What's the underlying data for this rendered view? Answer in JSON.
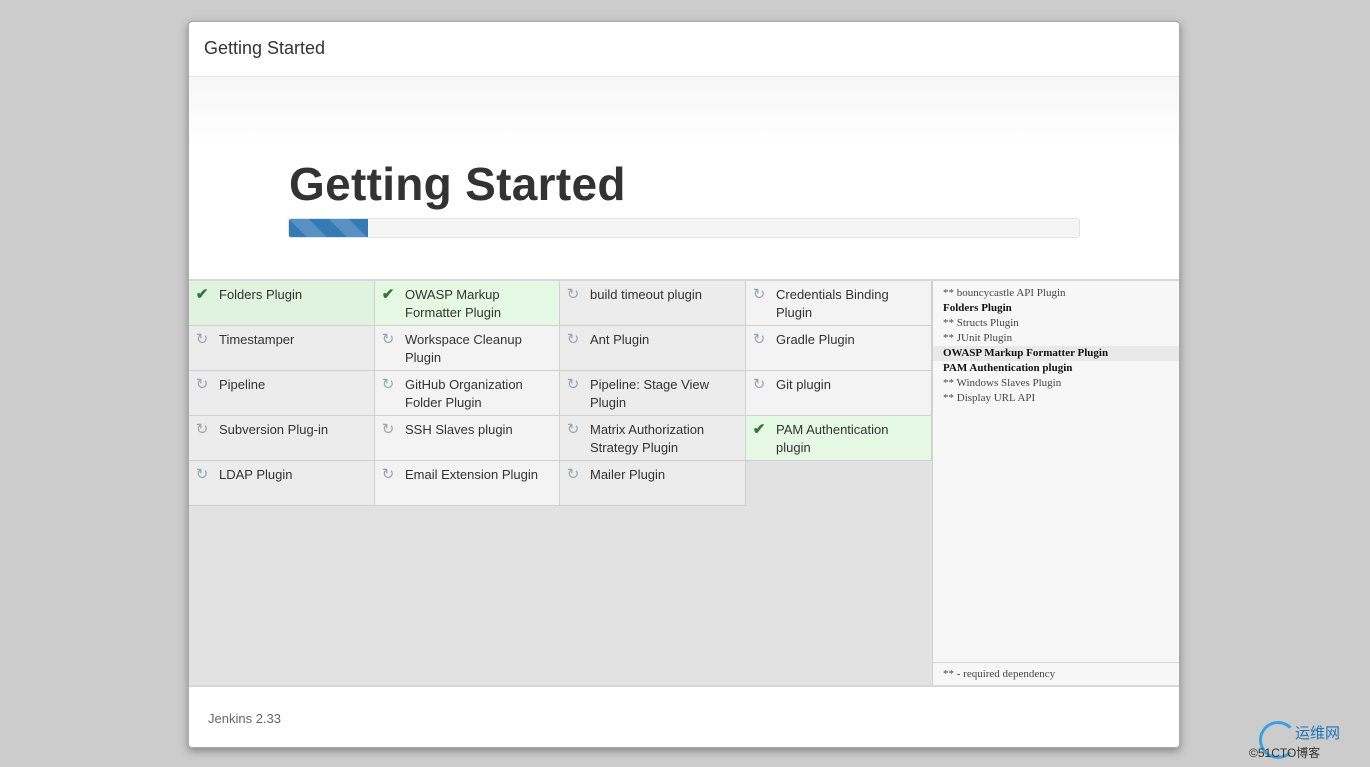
{
  "dialog": {
    "title": "Getting Started",
    "hero_title": "Getting Started",
    "progress_fraction": 0.1
  },
  "plugins": [
    {
      "label": "Folders Plugin",
      "status": "installed"
    },
    {
      "label": "OWASP Markup Formatter Plugin",
      "status": "installed"
    },
    {
      "label": "build timeout plugin",
      "status": "pending"
    },
    {
      "label": "Credentials Binding Plugin",
      "status": "pending"
    },
    {
      "label": "Timestamper",
      "status": "pending"
    },
    {
      "label": "Workspace Cleanup Plugin",
      "status": "pending"
    },
    {
      "label": "Ant Plugin",
      "status": "pending"
    },
    {
      "label": "Gradle Plugin",
      "status": "pending"
    },
    {
      "label": "Pipeline",
      "status": "pending"
    },
    {
      "label": "GitHub Organization Folder Plugin",
      "status": "pending"
    },
    {
      "label": "Pipeline: Stage View Plugin",
      "status": "pending"
    },
    {
      "label": "Git plugin",
      "status": "pending"
    },
    {
      "label": "Subversion Plug-in",
      "status": "pending"
    },
    {
      "label": "SSH Slaves plugin",
      "status": "pending"
    },
    {
      "label": "Matrix Authorization Strategy Plugin",
      "status": "pending"
    },
    {
      "label": "PAM Authentication plugin",
      "status": "installed"
    },
    {
      "label": "LDAP Plugin",
      "status": "pending"
    },
    {
      "label": "Email Extension Plugin",
      "status": "pending"
    },
    {
      "label": "Mailer Plugin",
      "status": "pending"
    }
  ],
  "install_log": {
    "lines": [
      {
        "text": "** bouncycastle API Plugin",
        "installed": false
      },
      {
        "text": "Folders Plugin",
        "installed": true
      },
      {
        "text": "** Structs Plugin",
        "installed": false
      },
      {
        "text": "** JUnit Plugin",
        "installed": false
      },
      {
        "text": "OWASP Markup Formatter Plugin",
        "installed": true,
        "highlight": true
      },
      {
        "text": "PAM Authentication plugin",
        "installed": true
      },
      {
        "text": "** Windows Slaves Plugin",
        "installed": false
      },
      {
        "text": "** Display URL API",
        "installed": false
      }
    ],
    "legend": "** - required dependency"
  },
  "footer": {
    "version": "Jenkins 2.33"
  },
  "watermark": {
    "brand": "运维网",
    "sub": "©51CTO博客"
  },
  "icons": {
    "installed": "check-icon",
    "pending": "refresh-icon"
  },
  "colors": {
    "progress": "#337ab7",
    "installed_bg": "#dff3df",
    "check": "#2f7a2f"
  }
}
